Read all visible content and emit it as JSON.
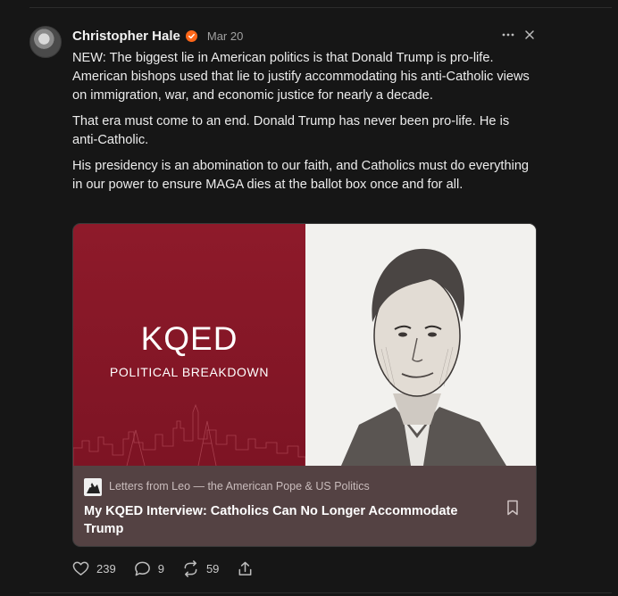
{
  "post": {
    "author": "Christopher Hale",
    "date": "Mar 20",
    "paragraphs": [
      "NEW: The biggest lie in American politics is that Donald Trump is pro-life. American bishops used that lie to justify accommodating his anti-Catholic views on immigration, war, and economic justice for nearly a decade.",
      "That era must come to an end. Donald Trump has never been pro-life. He is anti-Catholic.",
      "His presidency is an abomination to our faith, and Catholics must do everything in our power to ensure MAGA dies at the ballot box once and for all."
    ],
    "more_icon": "ellipsis-icon",
    "close_icon": "close-icon"
  },
  "card": {
    "image_brand": "KQED",
    "image_subtitle": "POLITICAL BREAKDOWN",
    "publication": "Letters from Leo — the American Pope & US Politics",
    "title": "My KQED Interview: Catholics Can No Longer Accommodate Trump",
    "bookmark_icon": "bookmark-icon"
  },
  "actions": {
    "likes": "239",
    "comments": "9",
    "restacks": "59"
  },
  "colors": {
    "background": "#161616",
    "verified_badge": "#ff6719",
    "card_footer": "#544243",
    "kqed_red": "#8e1a2a"
  }
}
